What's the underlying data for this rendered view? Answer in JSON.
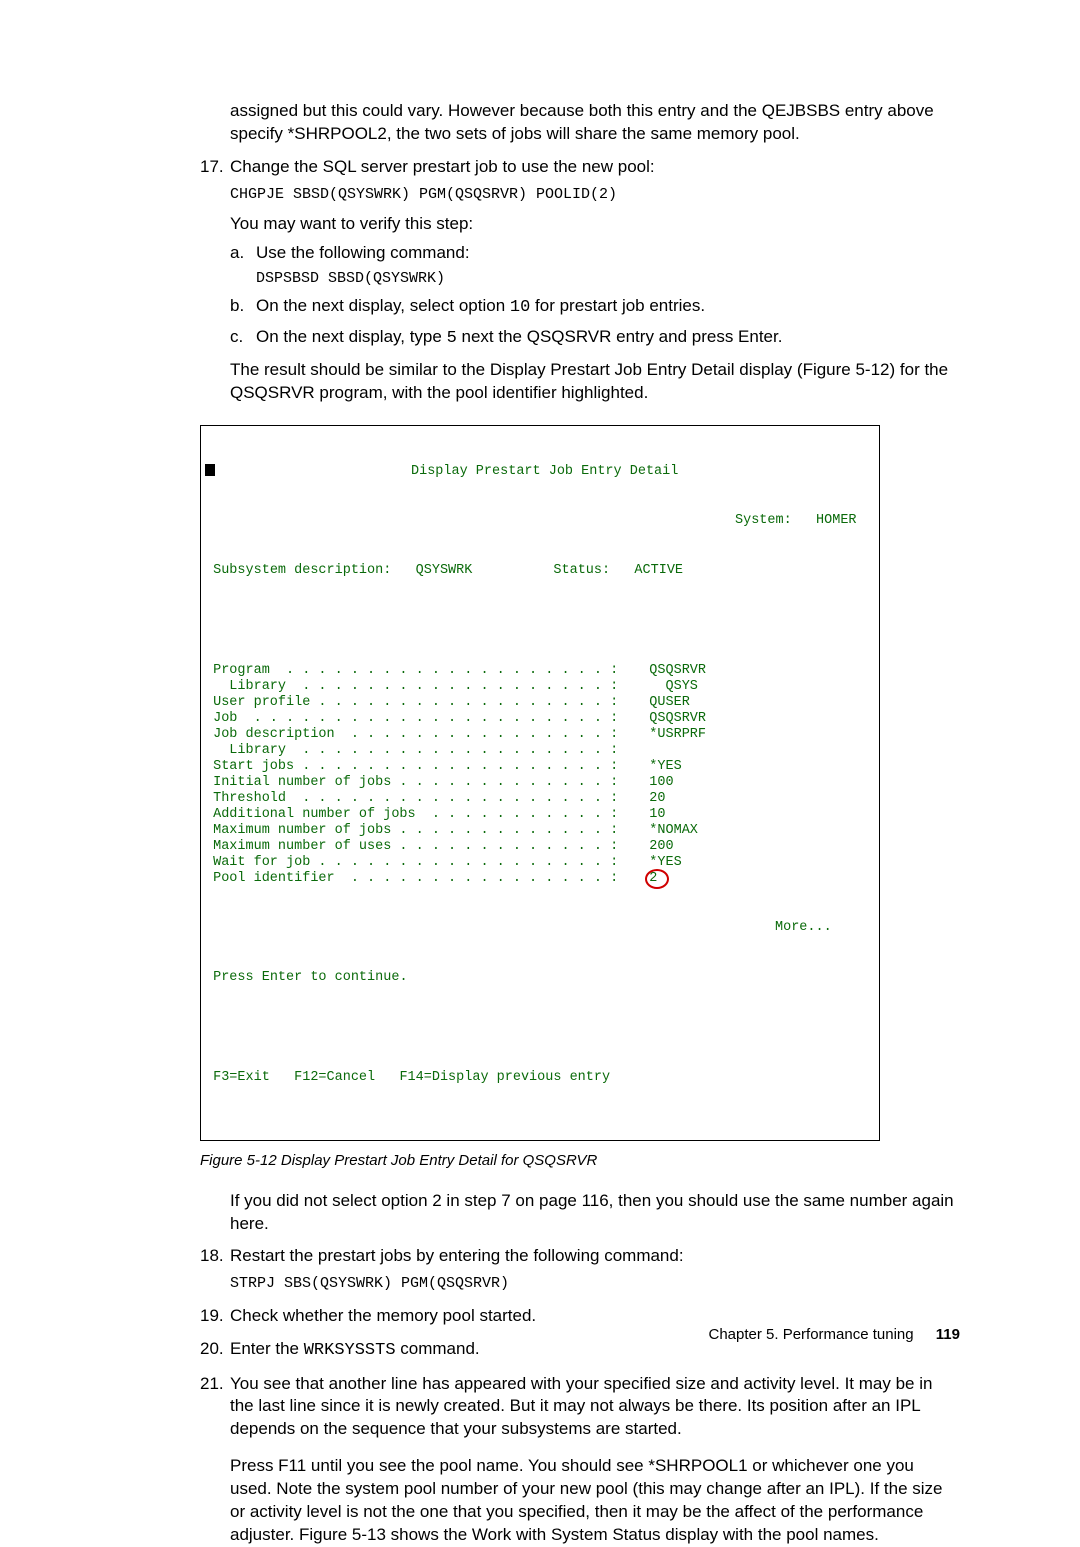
{
  "intro": "assigned but this could vary. However because both this entry and the QEJBSBS entry above specify *SHRPOOL2, the two sets of jobs will share the same memory pool.",
  "step17": {
    "num": "17.",
    "text": "Change the SQL server prestart job to use the new pool:",
    "cmd": "CHGPJE SBSD(QSYSWRK) PGM(QSQSRVR) POOLID(2)",
    "after": "You may want to verify this step:",
    "a_num": "a.",
    "a_text": "Use the following command:",
    "a_cmd": "DSPSBSD SBSD(QSYSWRK)",
    "b_num": "b.",
    "b_text_pre": "On the next display, select option ",
    "b_text_code": "10",
    "b_text_post": " for prestart job entries.",
    "c_num": "c.",
    "c_text_pre": "On the next display, type ",
    "c_text_code": "5",
    "c_text_post": " next the QSQSRVR entry and press Enter.",
    "result": "The result should be similar to the Display Prestart Job Entry Detail display (Figure 5-12) for the QSQSRVR program, with the pool identifier highlighted."
  },
  "terminal": {
    "title": "Display Prestart Job Entry Detail",
    "system_label": "System:",
    "system_value": "HOMER",
    "sub_label": "Subsystem description:",
    "sub_value": "QSYSWRK",
    "status_label": "Status:",
    "status_value": "ACTIVE",
    "rows": [
      {
        "label": "Program  . . . . . . . . . . . . . . . . . . . . :",
        "val": "QSQSRVR"
      },
      {
        "label": "  Library  . . . . . . . . . . . . . . . . . . . :",
        "val": "  QSYS"
      },
      {
        "label": "User profile . . . . . . . . . . . . . . . . . . :",
        "val": "QUSER"
      },
      {
        "label": "Job  . . . . . . . . . . . . . . . . . . . . . . :",
        "val": "QSQSRVR"
      },
      {
        "label": "Job description  . . . . . . . . . . . . . . . . :",
        "val": "*USRPRF"
      },
      {
        "label": "  Library  . . . . . . . . . . . . . . . . . . . :",
        "val": ""
      },
      {
        "label": "Start jobs . . . . . . . . . . . . . . . . . . . :",
        "val": "*YES"
      },
      {
        "label": "Initial number of jobs . . . . . . . . . . . . . :",
        "val": "100"
      },
      {
        "label": "Threshold  . . . . . . . . . . . . . . . . . . . :",
        "val": "20"
      },
      {
        "label": "Additional number of jobs  . . . . . . . . . . . :",
        "val": "10"
      },
      {
        "label": "Maximum number of jobs . . . . . . . . . . . . . :",
        "val": "*NOMAX"
      },
      {
        "label": "Maximum number of uses . . . . . . . . . . . . . :",
        "val": "200"
      },
      {
        "label": "Wait for job . . . . . . . . . . . . . . . . . . :",
        "val": "*YES"
      },
      {
        "label": "Pool identifier  . . . . . . . . . . . . . . . . :",
        "val": "2"
      }
    ],
    "more": "More...",
    "press": "Press Enter to continue.",
    "fkeys": "F3=Exit   F12=Cancel   F14=Display previous entry"
  },
  "fig_caption": "Figure 5-12   Display Prestart Job Entry Detail for QSQSRVR",
  "after_fig": "If you did not select option 2 in step 7 on page 116, then you should use the same number again here.",
  "step18": {
    "num": "18.",
    "text": "Restart the prestart jobs by entering the following command:",
    "cmd": "STRPJ SBS(QSYSWRK) PGM(QSQSRVR)"
  },
  "step19": {
    "num": "19.",
    "text": "Check whether the memory pool started."
  },
  "step20": {
    "num": "20.",
    "text_pre": "Enter the ",
    "text_code": "WRKSYSSTS",
    "text_post": " command."
  },
  "step21": {
    "num": "21.",
    "text": "You see that another line has appeared with your specified size and activity level. It may be in the last line since it is newly created. But it may not always be there. Its position after an IPL depends on the sequence that your subsystems are started.",
    "p2": "Press F11 until you see the pool name. You should see *SHRPOOL1 or whichever one you used. Note the system pool number of your new pool (this may change after an IPL). If the size or activity level is not the one that you specified, then it may be the affect of the performance adjuster. Figure 5-13 shows the Work with System Status display with the pool names."
  },
  "footer_chapter": "Chapter 5. Performance tuning",
  "footer_page": "119"
}
